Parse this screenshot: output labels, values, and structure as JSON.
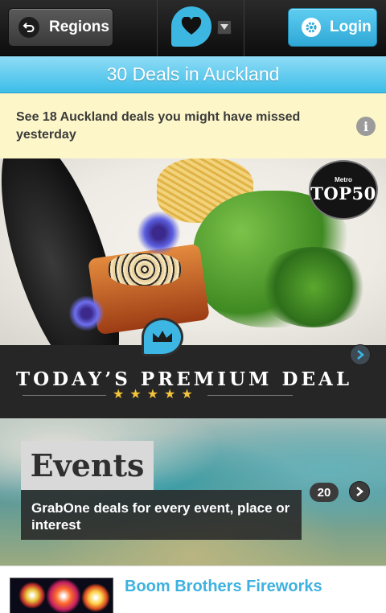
{
  "topbar": {
    "regions_label": "Regions",
    "login_label": "Login"
  },
  "deals_bar": {
    "title": "30 Deals in Auckland"
  },
  "notice": {
    "text": "See 18 Auckland deals you might have missed yesterday"
  },
  "premium": {
    "title": "TODAY’S PREMIUM DEAL",
    "badge_small": "Metro",
    "badge_big": "TOP50",
    "stars": "★★★★★",
    "star_count": 5
  },
  "events": {
    "label": "Events",
    "description": "GrabOne deals for every event, place or interest",
    "count": "20"
  },
  "deal_item": {
    "title": "Boom Brothers Fireworks"
  },
  "colors": {
    "accent": "#3cb7e2",
    "topbar": "#1a1a1a",
    "notice_bg": "#fdf6c8",
    "premium_band": "#262626",
    "star": "#f3c53a"
  },
  "icons": {
    "regions": "back-arrow-icon",
    "logo": "heart-bubble-icon",
    "dropdown": "triangle-down-icon",
    "login": "gear-icon",
    "notice": "info-icon",
    "premium": "crown-icon",
    "next": "chevron-right-icon"
  }
}
